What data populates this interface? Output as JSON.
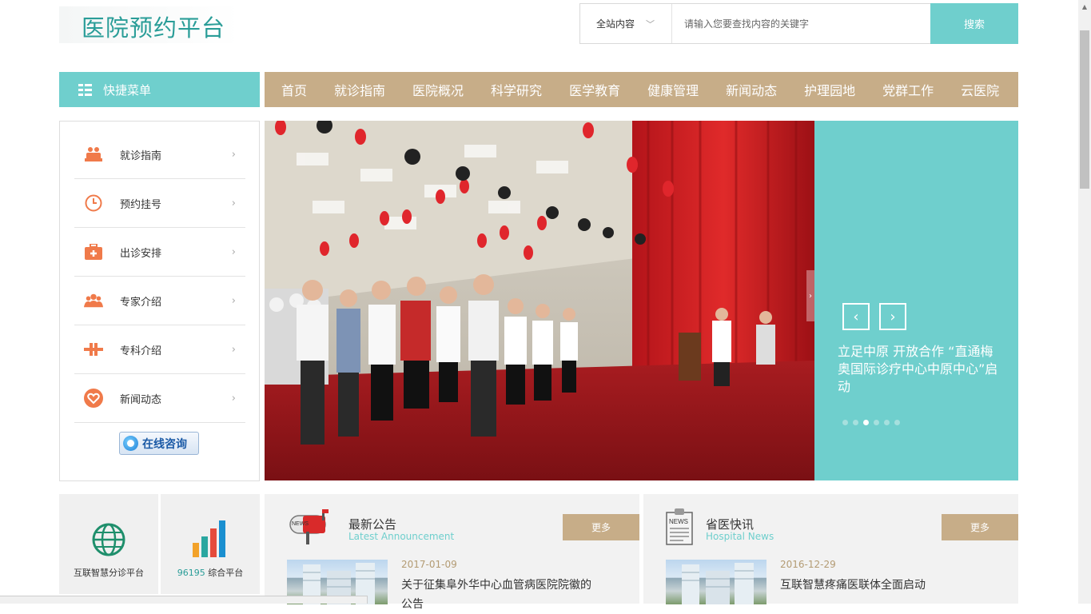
{
  "header": {
    "logo_text": "医院预约平台",
    "search_scope": "全站内容",
    "search_placeholder": "请输入您要查找内容的关键字",
    "search_button": "搜索"
  },
  "quick_menu": {
    "label": "快捷菜单"
  },
  "nav": {
    "items": [
      {
        "label": "首页"
      },
      {
        "label": "就诊指南"
      },
      {
        "label": "医院概况"
      },
      {
        "label": "科学研究"
      },
      {
        "label": "医学教育"
      },
      {
        "label": "健康管理"
      },
      {
        "label": "新闻动态"
      },
      {
        "label": "护理园地"
      },
      {
        "label": "党群工作"
      },
      {
        "label": "云医院"
      }
    ]
  },
  "sidebar": {
    "items": [
      {
        "label": "就诊指南",
        "icon": "doctors-icon"
      },
      {
        "label": "预约挂号",
        "icon": "clock-icon"
      },
      {
        "label": "出诊安排",
        "icon": "medical-kit-icon"
      },
      {
        "label": "专家介绍",
        "icon": "group-icon"
      },
      {
        "label": "专科介绍",
        "icon": "cross-icon"
      },
      {
        "label": "新闻动态",
        "icon": "heart-icon"
      }
    ],
    "online_consult": "在线咨询"
  },
  "banner": {
    "caption": "立足中原 开放合作 “直通梅奥国际诊疗中心中原中心”启动",
    "prev": "‹",
    "next": "›",
    "slide_count": 6,
    "active_slide": 3
  },
  "platforms": [
    {
      "label": "互联智慧分诊平台"
    },
    {
      "number": "96195",
      "label": "综合平台"
    }
  ],
  "panels": {
    "announcements": {
      "title": "最新公告",
      "subtitle": "Latest Announcement",
      "more": "更多",
      "date": "2017-01-09",
      "headline": "关于征集阜外华中心血管病医院院徽的公告"
    },
    "provincial_news": {
      "title": "省医快讯",
      "subtitle": "Hospital News",
      "more": "更多",
      "date": "2016-12-29",
      "headline": "互联智慧疼痛医联体全面启动"
    }
  },
  "colors": {
    "teal": "#6fcfcd",
    "tan": "#c7ad88",
    "logo": "#2a9d98",
    "icon_orange": "#f07a4a"
  }
}
